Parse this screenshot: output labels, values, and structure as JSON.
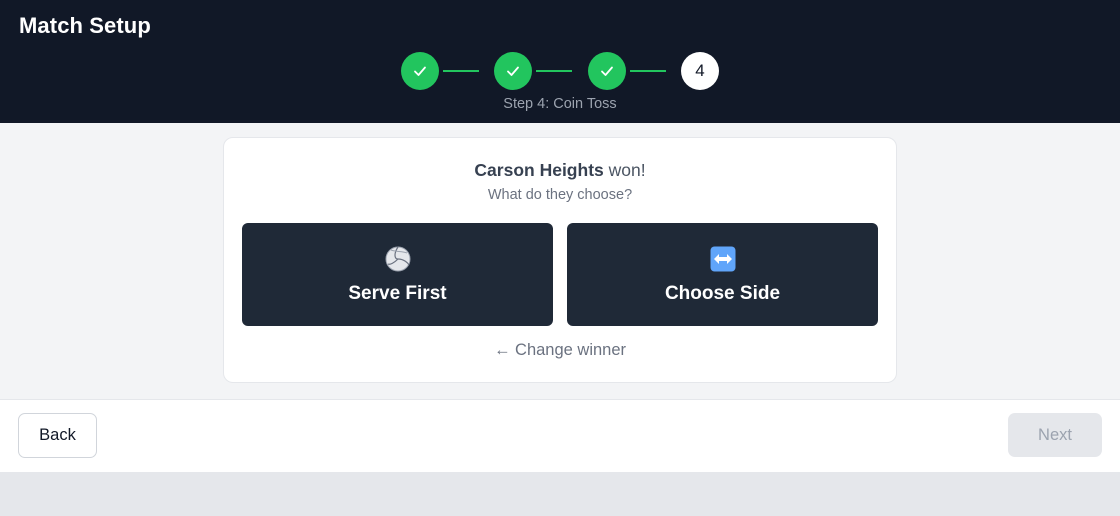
{
  "header": {
    "title": "Match Setup",
    "steps": [
      {
        "state": "done",
        "icon": "check-icon"
      },
      {
        "state": "done",
        "icon": "check-icon"
      },
      {
        "state": "done",
        "icon": "check-icon"
      },
      {
        "state": "current",
        "label": "4"
      }
    ],
    "step_caption": "Step 4: Coin Toss"
  },
  "toss": {
    "winner_team": "Carson Heights",
    "winner_suffix": " won!",
    "question": "What do they choose?",
    "options": [
      {
        "label": "Serve First",
        "icon": "volleyball-icon"
      },
      {
        "label": "Choose Side",
        "icon": "left-right-arrow-icon"
      }
    ],
    "change_winner": "← Change winner"
  },
  "footer": {
    "back_label": "Back",
    "next_label": "Next",
    "next_disabled": true
  },
  "colors": {
    "header_bg": "#111827",
    "done_step": "#22c55e",
    "choice_bg": "#1f2937"
  }
}
